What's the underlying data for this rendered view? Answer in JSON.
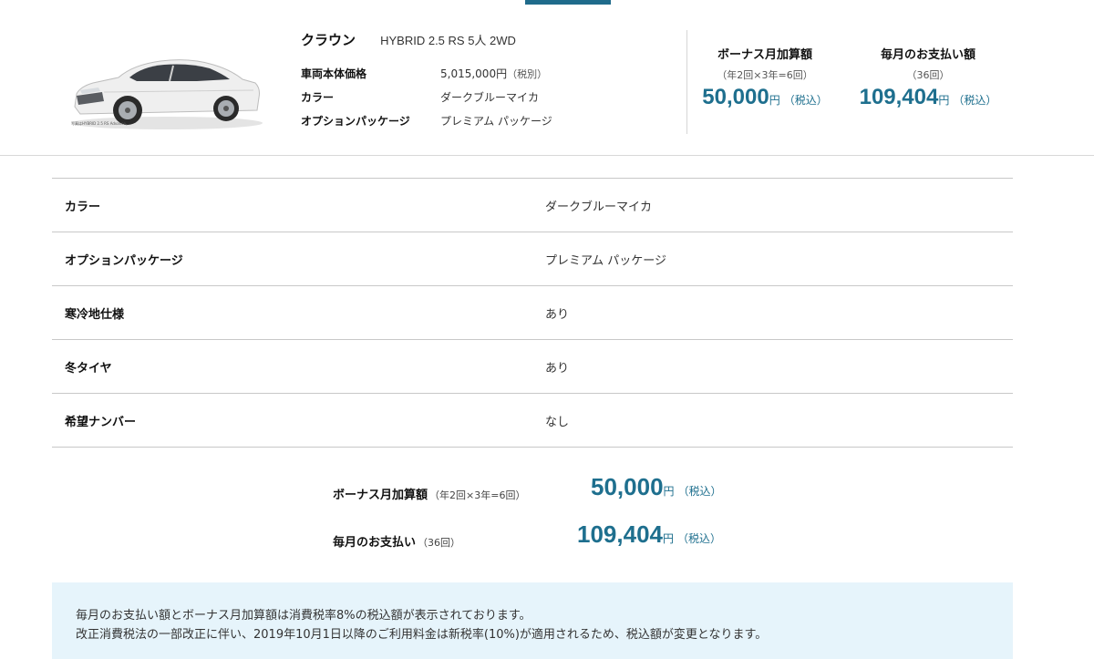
{
  "summary": {
    "car_image_caption": "写真はHYBRID 2.5 RS Advance。",
    "model_name": "クラウン",
    "model_grade": "HYBRID 2.5 RS 5人 2WD",
    "specs": [
      {
        "label": "車両本体価格",
        "value": "5,015,000円",
        "note": "（税別）"
      },
      {
        "label": "カラー",
        "value": "ダークブルーマイカ",
        "note": ""
      },
      {
        "label": "オプションパッケージ",
        "value": "プレミアム パッケージ",
        "note": ""
      }
    ],
    "bonus": {
      "title": "ボーナス月加算額",
      "sub": "（年2回×3年=6回）",
      "amount": "50,000",
      "unit": "円",
      "tax": "（税込）"
    },
    "monthly": {
      "title": "毎月のお支払い額",
      "sub": "（36回）",
      "amount": "109,404",
      "unit": "円",
      "tax": "（税込）"
    }
  },
  "detail_table": [
    {
      "label": "カラー",
      "value": "ダークブルーマイカ"
    },
    {
      "label": "オプションパッケージ",
      "value": "プレミアム パッケージ"
    },
    {
      "label": "寒冷地仕様",
      "value": "あり"
    },
    {
      "label": "冬タイヤ",
      "value": "あり"
    },
    {
      "label": "希望ナンバー",
      "value": "なし"
    }
  ],
  "totals": {
    "bonus": {
      "label": "ボーナス月加算額",
      "sub": "（年2回×3年=6回）",
      "amount": "50,000",
      "unit": "円",
      "tax": "（税込）"
    },
    "monthly": {
      "label": "毎月のお支払い",
      "sub": "（36回）",
      "amount": "109,404",
      "unit": "円",
      "tax": "（税込）"
    }
  },
  "notice": {
    "line1": "毎月のお支払い額とボーナス月加算額は消費税率8%の税込額が表示されております。",
    "line2": "改正消費税法の一部改正に伴い、2019年10月1日以降のご利用料金は新税率(10%)が適用されるため、税込額が変更となります。"
  },
  "colors": {
    "accent": "#1e6f8e",
    "tab_indicator": "#1f6b8b",
    "notice_bg": "#e6f4fb"
  }
}
